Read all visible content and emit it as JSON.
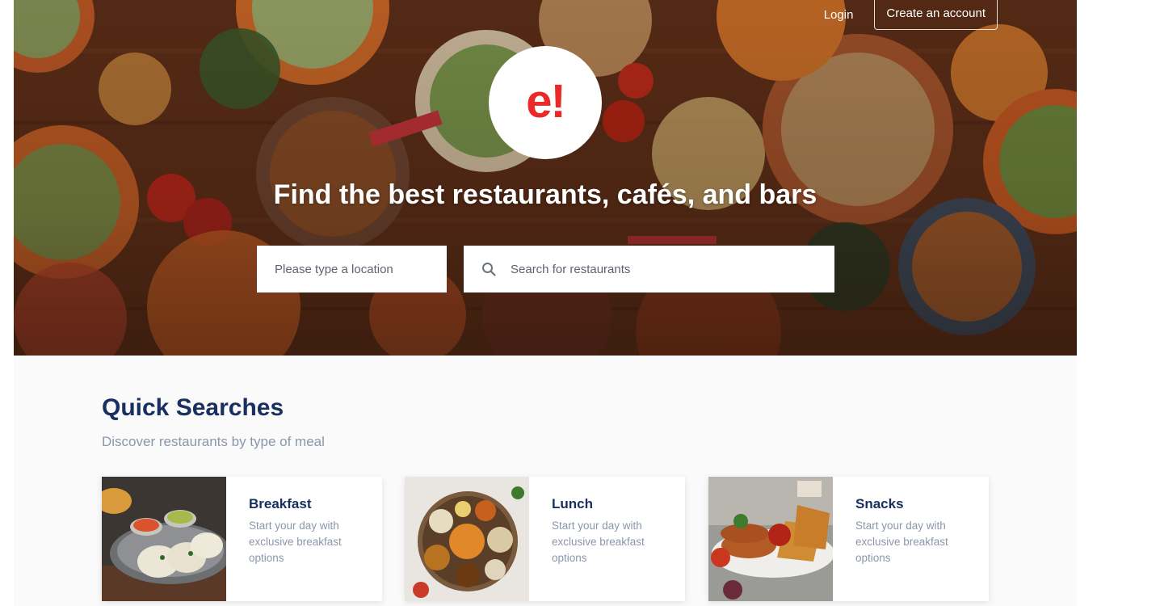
{
  "nav": {
    "login_label": "Login",
    "signup_label": "Create an account"
  },
  "logo": {
    "text": "e!"
  },
  "hero": {
    "headline": "Find the best restaurants, cafés, and bars"
  },
  "search": {
    "location_placeholder": "Please type a location",
    "restaurant_placeholder": "Search for restaurants"
  },
  "quick_searches": {
    "title": "Quick Searches",
    "subtitle": "Discover restaurants by type of meal",
    "cards": [
      {
        "name": "Breakfast",
        "description": "Start your day with exclusive breakfast options"
      },
      {
        "name": "Lunch",
        "description": "Start your day with exclusive breakfast options"
      },
      {
        "name": "Snacks",
        "description": "Start your day with exclusive breakfast options"
      }
    ]
  },
  "colors": {
    "brand_red": "#eb2929",
    "heading_navy": "#192f60",
    "muted_text": "#8c96ab"
  },
  "icons": {
    "search": "search-icon"
  }
}
